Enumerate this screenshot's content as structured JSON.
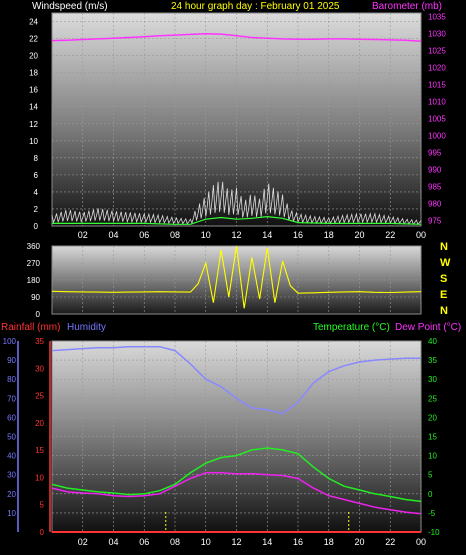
{
  "colors": {
    "windspeed": "#ffffff",
    "windgust": "#dddddd",
    "windavg": "#33ff33",
    "barometer": "#ff33ff",
    "direction": "#ffff00",
    "rainfall": "#ff3333",
    "humidity": "#8888ff",
    "temperature": "#22ee22",
    "dewpoint": "#ee22ee",
    "title": "#ffff00",
    "label_white": "#ffffff",
    "label_blue": "#7777ff",
    "label_green": "#22ff22",
    "label_magenta": "#ff33ff",
    "label_red": "#ff3333"
  },
  "header": {
    "left_label": "Windspeed (m/s)",
    "title": "24 hour graph day : February 01 2025",
    "right_label": "Barometer (mb)"
  },
  "x_ticks": [
    "02",
    "04",
    "06",
    "08",
    "10",
    "12",
    "14",
    "16",
    "18",
    "20",
    "22",
    "00"
  ],
  "compass": [
    "N",
    "W",
    "S",
    "E",
    "N"
  ],
  "bottom_header": {
    "rainfall": "Rainfall (mm)",
    "humidity": "Humidity",
    "temperature": "Temperature (°C)",
    "dewpoint": "Dew Point (°C)"
  },
  "chart_data": [
    {
      "type": "line",
      "x_unit": "hour",
      "xlim": [
        0,
        24
      ],
      "y_left": {
        "ticks": [
          0,
          2,
          4,
          6,
          8,
          10,
          12,
          14,
          16,
          18,
          20,
          22,
          24
        ],
        "ylim": [
          0,
          25
        ]
      },
      "y_right": {
        "ticks": [
          975,
          980,
          985,
          990,
          995,
          1000,
          1005,
          1010,
          1015,
          1020,
          1025,
          1030,
          1035
        ],
        "ylim": [
          973.4,
          1036
        ]
      },
      "series": [
        {
          "name": "Barometer (mb)",
          "axis": "right",
          "x": [
            0,
            1,
            2,
            3,
            4,
            5,
            6,
            7,
            8,
            9,
            10,
            11,
            12,
            13,
            14,
            15,
            16,
            17,
            18,
            19,
            20,
            21,
            22,
            23,
            24
          ],
          "values": [
            1027.9,
            1028,
            1028.2,
            1028.4,
            1028.6,
            1028.8,
            1029,
            1029.3,
            1029.5,
            1029.7,
            1029.9,
            1029.8,
            1029.3,
            1028.8,
            1028.6,
            1028.4,
            1028.3,
            1028.3,
            1028.4,
            1028.4,
            1028.3,
            1028.2,
            1028.1,
            1028,
            1027.7
          ]
        },
        {
          "name": "Windspeed (m/s)",
          "axis": "left",
          "x": [
            0,
            1,
            2,
            3,
            4,
            5,
            6,
            7,
            8,
            9,
            9.5,
            10,
            10.5,
            11,
            11.5,
            12,
            12.5,
            13,
            13.5,
            14,
            14.5,
            15,
            15.5,
            16,
            17,
            18,
            19,
            20,
            21,
            22,
            23,
            24
          ],
          "values": [
            0.8,
            1.2,
            1,
            1.3,
            1.1,
            1,
            0.9,
            0.8,
            0.6,
            0.5,
            1.5,
            2.2,
            3.0,
            3.4,
            2.6,
            2.8,
            1.8,
            2.4,
            2.0,
            3.2,
            2.7,
            2.3,
            1.2,
            0.9,
            0.7,
            0.6,
            0.8,
            0.9,
            0.9,
            0.7,
            0.5,
            0.4
          ]
        },
        {
          "name": "Average wind",
          "axis": "left",
          "x": [
            0,
            2,
            4,
            6,
            8,
            9,
            10,
            11,
            12,
            13,
            14,
            15,
            16,
            18,
            20,
            22,
            24
          ],
          "values": [
            0.3,
            0.3,
            0.3,
            0.3,
            0.2,
            0.2,
            0.8,
            1.0,
            0.8,
            0.9,
            1.1,
            0.9,
            0.4,
            0.3,
            0.3,
            0.3,
            0.2
          ]
        }
      ]
    },
    {
      "type": "scatter",
      "title": "Wind direction",
      "xlim": [
        0,
        24
      ],
      "y_ticks": [
        0,
        90,
        180,
        270,
        360
      ],
      "ylim": [
        0,
        360
      ],
      "series": [
        {
          "name": "Direction",
          "x": [
            0,
            1,
            2,
            3,
            4,
            5,
            6,
            7,
            8,
            9,
            9.5,
            10,
            10.5,
            11,
            11.5,
            12,
            12.5,
            13,
            13.5,
            14,
            14.5,
            15,
            15.5,
            16,
            17,
            18,
            19,
            20,
            21,
            22,
            23,
            24
          ],
          "values": [
            120,
            118,
            117,
            116,
            115,
            116,
            117,
            118,
            117,
            116,
            160,
            270,
            60,
            340,
            90,
            360,
            30,
            300,
            80,
            350,
            60,
            280,
            150,
            110,
            112,
            115,
            117,
            118,
            115,
            114,
            116,
            118
          ]
        }
      ]
    },
    {
      "type": "line",
      "xlim": [
        0,
        24
      ],
      "y_left_humidity": {
        "ticks": [
          10,
          20,
          30,
          40,
          50,
          60,
          70,
          80,
          90,
          100
        ],
        "ylim": [
          0,
          100
        ]
      },
      "y_left_rainfall": {
        "ticks": [
          0,
          5,
          10,
          15,
          20,
          25,
          30,
          35
        ],
        "ylim": [
          0,
          35
        ]
      },
      "y_right": {
        "ticks": [
          -10,
          -5,
          0,
          5,
          10,
          15,
          20,
          25,
          30,
          35,
          40
        ],
        "ylim": [
          -10,
          40
        ]
      },
      "series": [
        {
          "name": "Humidity",
          "axis": "humidity",
          "x": [
            0,
            1,
            2,
            3,
            4,
            5,
            6,
            7,
            8,
            9,
            10,
            11,
            12,
            13,
            14,
            15,
            16,
            17,
            18,
            19,
            20,
            21,
            22,
            23,
            24
          ],
          "values": [
            95,
            95.5,
            96,
            96.5,
            96.5,
            97,
            97,
            97,
            95,
            88,
            80,
            76,
            70,
            65,
            64,
            62,
            68,
            78,
            84,
            87,
            89,
            90,
            90.5,
            91,
            91
          ]
        },
        {
          "name": "Temperature (°C)",
          "axis": "right",
          "x": [
            0,
            1,
            2,
            3,
            4,
            5,
            6,
            7,
            8,
            9,
            10,
            11,
            12,
            13,
            14,
            15,
            16,
            17,
            18,
            19,
            20,
            21,
            22,
            23,
            24
          ],
          "values": [
            2.5,
            1.5,
            1,
            0.5,
            0.2,
            -0.2,
            0,
            0.8,
            2.5,
            5.5,
            8,
            9.5,
            10,
            11.5,
            12,
            11.5,
            10.5,
            7,
            4,
            2,
            1,
            0,
            -0.7,
            -1.5,
            -2
          ]
        },
        {
          "name": "Dew Point (°C)",
          "axis": "right",
          "x": [
            0,
            1,
            2,
            3,
            4,
            5,
            6,
            7,
            8,
            9,
            10,
            11,
            12,
            13,
            14,
            15,
            16,
            17,
            18,
            19,
            20,
            21,
            22,
            23,
            24
          ],
          "values": [
            1.5,
            0.5,
            0.2,
            0,
            -0.5,
            -0.7,
            -0.5,
            0,
            2,
            4,
            5.5,
            5.5,
            5.2,
            5.3,
            5,
            4.8,
            4,
            1.5,
            -0.5,
            -1.5,
            -2.5,
            -3.5,
            -4.2,
            -4.8,
            -5.2
          ]
        },
        {
          "name": "Rainfall (mm)",
          "axis": "rainfall",
          "x": [
            0,
            24
          ],
          "values": [
            0,
            0
          ]
        }
      ],
      "markers_x": [
        7.4,
        19.3
      ]
    }
  ]
}
